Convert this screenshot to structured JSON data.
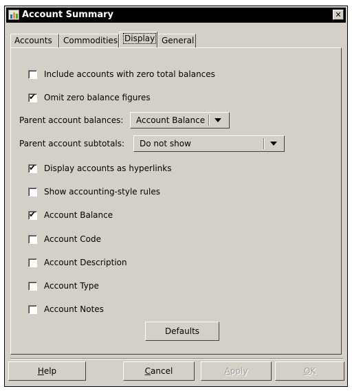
{
  "window": {
    "title": "Account Summary",
    "close_glyph": "✕"
  },
  "tabs": [
    {
      "label": "Accounts"
    },
    {
      "label": "Commodities"
    },
    {
      "label": "Display",
      "active": true
    },
    {
      "label": "General"
    }
  ],
  "options": {
    "zero_total": {
      "label": "Include accounts with zero total balances",
      "checked": false
    },
    "omit_zero": {
      "label": "Omit zero balance figures",
      "checked": true
    },
    "parent_balances": {
      "label": "Parent account balances:",
      "value": "Account Balance"
    },
    "parent_subtotals": {
      "label": "Parent account subtotals:",
      "value": "Do not show"
    },
    "hyperlinks": {
      "label": "Display accounts as hyperlinks",
      "checked": true
    },
    "accounting_rules": {
      "label": "Show accounting-style rules",
      "checked": false
    },
    "account_balance": {
      "label": "Account Balance",
      "checked": true
    },
    "account_code": {
      "label": "Account Code",
      "checked": false
    },
    "account_description": {
      "label": "Account Description",
      "checked": false
    },
    "account_type": {
      "label": "Account Type",
      "checked": false
    },
    "account_notes": {
      "label": "Account Notes",
      "checked": false
    }
  },
  "defaults_label": "Defaults",
  "footer": {
    "help": {
      "pre": "",
      "ul": "H",
      "post": "elp"
    },
    "cancel": {
      "pre": "",
      "ul": "C",
      "post": "ancel"
    },
    "apply": {
      "pre": "",
      "ul": "A",
      "post": "pply"
    },
    "ok": {
      "pre": "",
      "ul": "O",
      "post": "K"
    }
  },
  "check_glyph": "✔",
  "colors": {
    "face": "#d4d0c8",
    "titlebar": "#000000",
    "disabled_text": "#a0a0a0"
  }
}
